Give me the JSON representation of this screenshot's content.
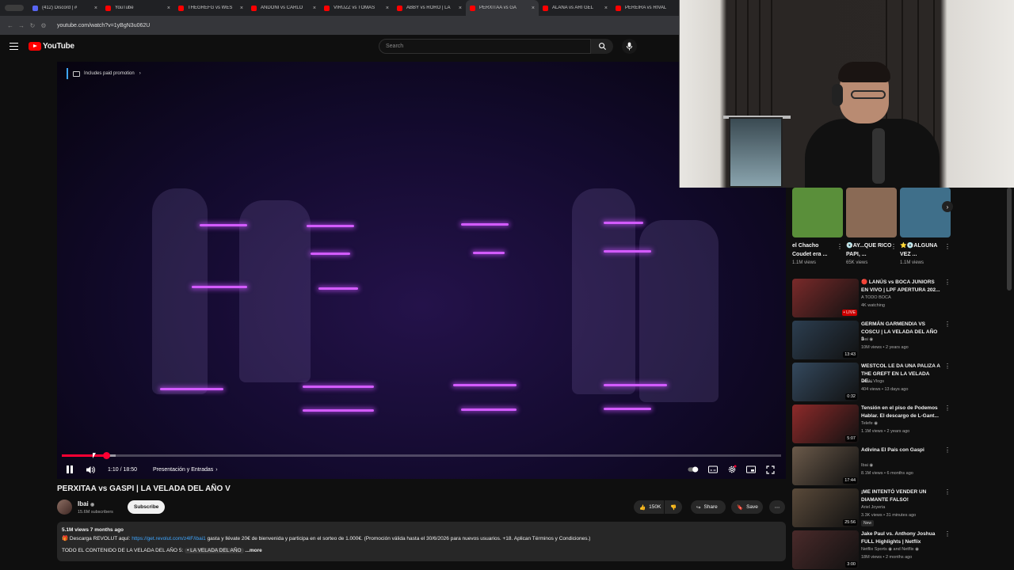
{
  "browser": {
    "tabs": [
      {
        "label": "(412) Discord | #",
        "close": "×"
      },
      {
        "label": "YouTube",
        "close": "×"
      },
      {
        "label": "THEGREFG vs WES",
        "close": "×"
      },
      {
        "label": "ANDONI vs CARLO",
        "close": "×"
      },
      {
        "label": "VIRUZZ vs TOMÁS",
        "close": "×"
      },
      {
        "label": "ABBY vs RORO | LA",
        "close": "×"
      },
      {
        "label": "PERXITAA vs GA",
        "close": "×"
      },
      {
        "label": "ALANA vs ARI GEL",
        "close": "×"
      },
      {
        "label": "PEREIRA vs RIVAL",
        "close": ""
      }
    ],
    "url": "youtube.com/watch?v=1yBgN3u062U"
  },
  "header": {
    "logo_text": "YouTube",
    "search_placeholder": "Search"
  },
  "player": {
    "promo_text": "Includes paid promotion",
    "current_time": "1:10",
    "duration": "18:50",
    "time_display": "1:10 / 18:50",
    "chapter": "Presentación y Entradas",
    "progress_fraction": 0.0619,
    "buffered_fraction": 0.075
  },
  "video": {
    "title": "PERXITAA vs GASPI | LA VELADA DEL AÑO V",
    "channel_name": "Ibai",
    "subscribers": "15.6M subscribers",
    "subscribe_label": "Subscribe",
    "likes": "150K",
    "share_label": "Share",
    "save_label": "Save",
    "more_icon": "⋯"
  },
  "description": {
    "meta": "5.1M views  7 months ago",
    "line1_prefix": "🎁 Descarga REVOLUT aquí: ",
    "line1_link": "https://get.revolut.com/z4lF/ibai1",
    "line1_suffix": " gasta y llévate 20€ de bienvenida y participa en el sorteo de 1.000€. (Promoción válida hasta el 30/6/2026 para nuevos usuarios. +18. Aplican Términos y Condiciones.)",
    "line2": "TODO EL CONTENIDO DE LA VELADA DEL AÑO 5: ",
    "line2_link": "• LA VELADA DEL AÑO",
    "more": "...more"
  },
  "shorts": [
    {
      "title": "el Chacho Coudet era ...",
      "views": "1.1M views",
      "color": "#5a8f3a"
    },
    {
      "title": "💿AY...QUE RICO PAPI, ...",
      "views": "65K views",
      "color": "#8a6a55"
    },
    {
      "title": "⭐💿ALGUNA VEZ ...",
      "views": "1.1M views",
      "color": "#3f6f8a"
    }
  ],
  "recommendations": [
    {
      "title": "🔴 LANÚS vs BOCA JUNIORS EN VIVO | LPF APERTURA 202...",
      "channel": "A TODO BOCA",
      "meta": "4K watching",
      "duration": "• LIVE",
      "live": true,
      "color": "#7a2a2a"
    },
    {
      "title": "GERMÁN GARMENDIA VS COSCU | LA VELADA DEL AÑO 3",
      "channel": "Ibai ◉",
      "meta": "10M views • 2 years ago",
      "duration": "13:43",
      "live": false,
      "color": "#2c3e50"
    },
    {
      "title": "WESTCOL LE DA UNA PALIZA A THE GREFT EN LA VELADA DE...",
      "channel": "Haski Vlogs",
      "meta": "404 views • 13 days ago",
      "duration": "0:32",
      "live": false,
      "color": "#34495e"
    },
    {
      "title": "Tensión en el piso de Podemos Hablar. El descargo de L-Gant...",
      "channel": "Telefe ◉",
      "meta": "1.1M views • 2 years ago",
      "duration": "5:07",
      "live": false,
      "color": "#8e2a2a"
    },
    {
      "title": "Adivina El País con Gaspi",
      "channel": "Ibai ◉",
      "meta": "8.1M views • 6 months ago",
      "duration": "17:44",
      "live": false,
      "color": "#6b5a4a"
    },
    {
      "title": "¡ME INTENTÓ VENDER UN DIAMANTE FALSO!",
      "channel": "Ariel Joyeria",
      "meta": "3.3K views • 31 minutes ago",
      "duration": "25:56",
      "live": false,
      "badge": "New",
      "color": "#5a4a3a"
    },
    {
      "title": "Jake Paul vs. Anthony Joshua FULL Highlights | Netflix",
      "channel": "Netflix Sports ◉ and Netflix ◉",
      "meta": "18M views • 2 months ago",
      "duration": "3:00",
      "live": false,
      "color": "#4a2a2a"
    }
  ],
  "colors": {
    "accent": "#ff0033",
    "link": "#3ea6ff",
    "bg": "#0f0f0f"
  }
}
